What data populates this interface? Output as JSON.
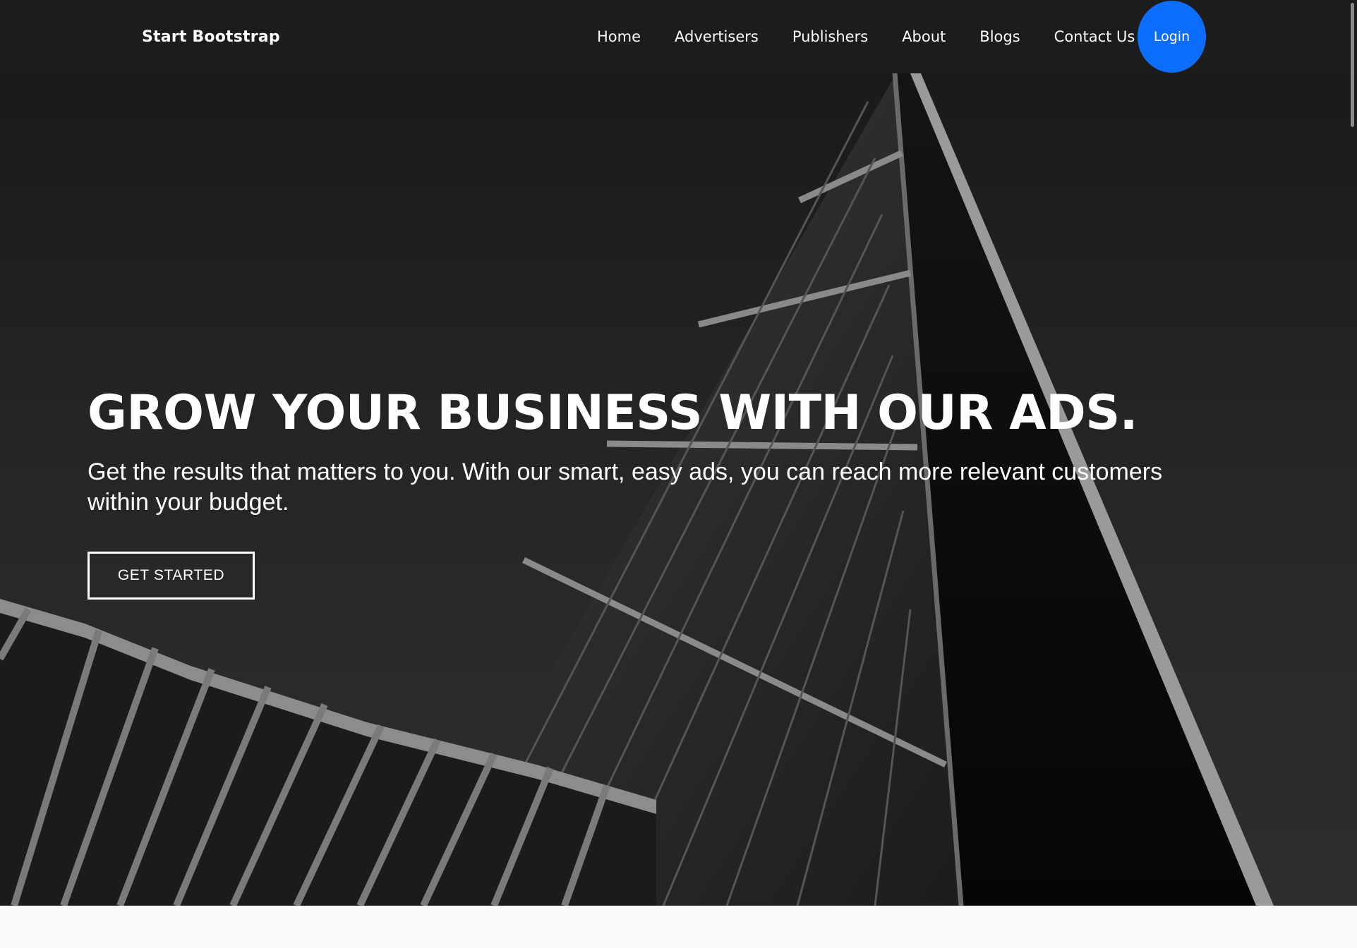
{
  "navbar": {
    "brand": "Start Bootstrap",
    "links": [
      {
        "label": "Home"
      },
      {
        "label": "Advertisers"
      },
      {
        "label": "Publishers"
      },
      {
        "label": "About"
      },
      {
        "label": "Blogs"
      },
      {
        "label": "Contact Us"
      }
    ],
    "login_label": "Login"
  },
  "hero": {
    "title": "GROW YOUR BUSINESS WITH OUR ADS.",
    "subtitle": "Get the results that matters to you. With our smart, easy ads, you can reach more relevant customers within your budget.",
    "cta_label": "GET STARTED"
  },
  "colors": {
    "navbar_bg": "#1c1c1d",
    "login_button": "#0d6efd",
    "text": "#ffffff",
    "page_bg": "#f8f9fa"
  }
}
